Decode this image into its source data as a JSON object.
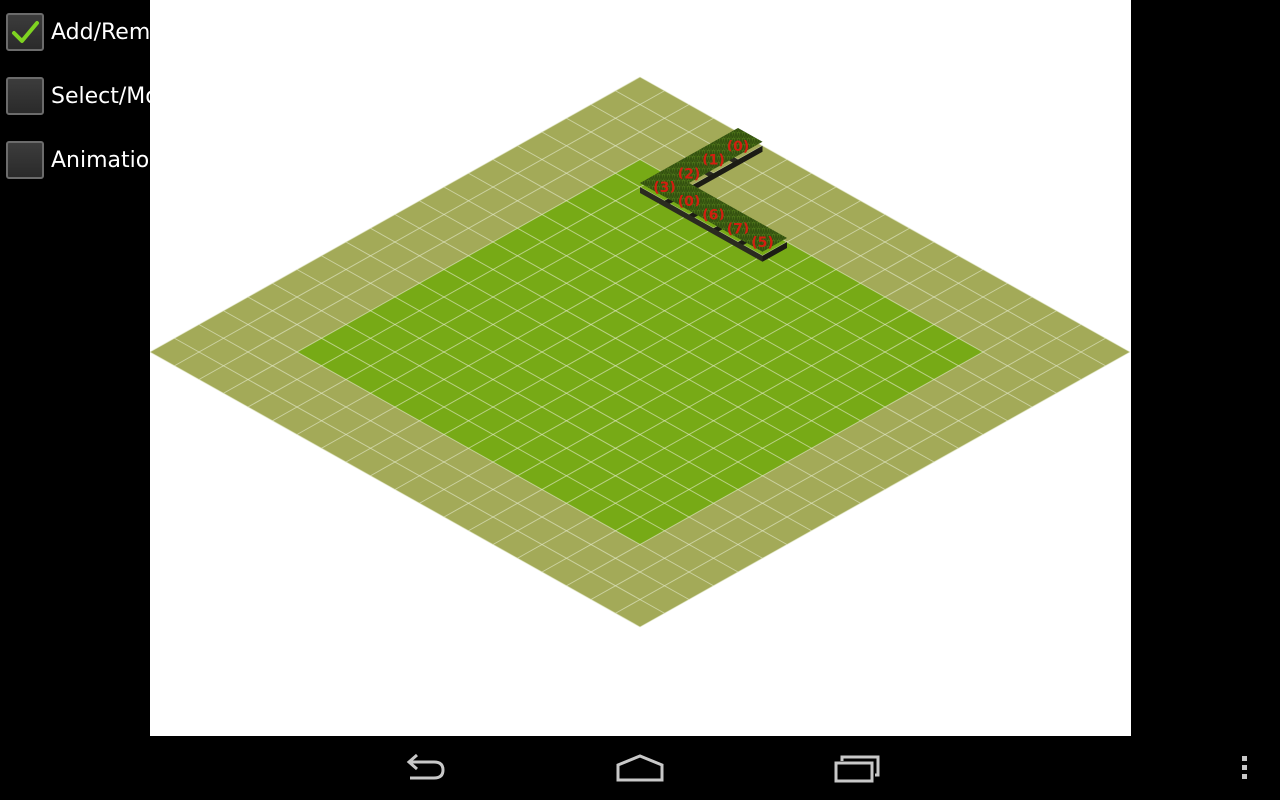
{
  "options": [
    {
      "label": "Add/Remove",
      "checked": true
    },
    {
      "label": "Select/Move",
      "checked": false
    },
    {
      "label": "Animation",
      "checked": false
    }
  ],
  "map": {
    "size": 20,
    "inner_margin": 3,
    "tiles": [
      {
        "label": "(0)",
        "row": 0,
        "col": 4
      },
      {
        "label": "(1)",
        "row": 1,
        "col": 4
      },
      {
        "label": "(2)",
        "row": 2,
        "col": 4
      },
      {
        "label": "(3)",
        "row": 3,
        "col": 4
      },
      {
        "label": "(0)",
        "row": 3,
        "col": 5
      },
      {
        "label": "(6)",
        "row": 3,
        "col": 6
      },
      {
        "label": "(7)",
        "row": 3,
        "col": 7
      },
      {
        "label": "(5)",
        "row": 3,
        "col": 8
      }
    ]
  },
  "colors": {
    "outer_tile": "#a3aa58",
    "inner_tile": "#77aa16",
    "grid_line": "#e6ebcf",
    "tile_label": "#d21e10",
    "grass": "#3e5e14"
  },
  "nav": {
    "back_icon": "back-icon",
    "home_icon": "home-icon",
    "recents_icon": "recents-icon",
    "menu_icon": "overflow-menu-icon"
  }
}
